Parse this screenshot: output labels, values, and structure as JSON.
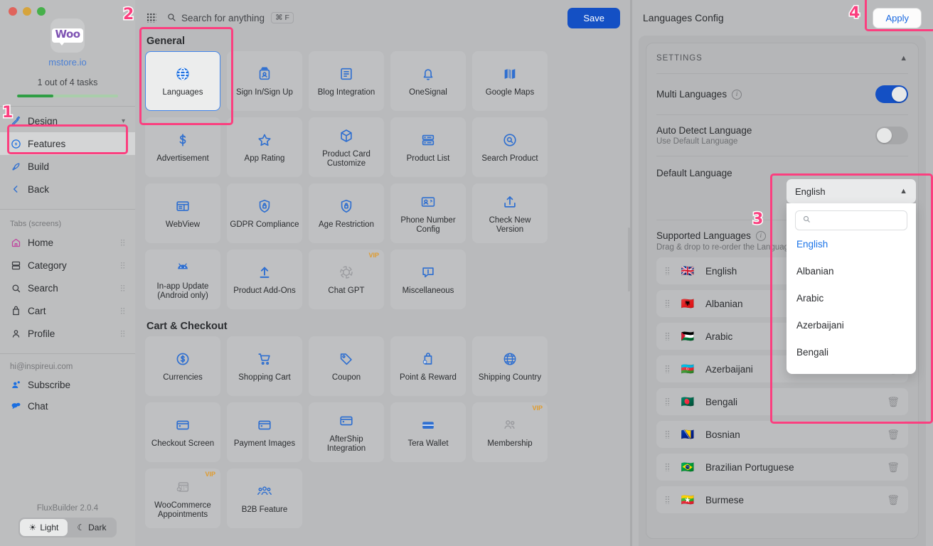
{
  "sidebar": {
    "brand_name": "mstore.io",
    "logo_text": "Woo",
    "tasks_text": "1 out of 4 tasks",
    "nav": [
      {
        "label": "Design",
        "icon": "palette-icon",
        "active": false
      },
      {
        "label": "Features",
        "icon": "bolt-icon",
        "active": true
      },
      {
        "label": "Build",
        "icon": "rocket-icon",
        "active": false
      },
      {
        "label": "Back",
        "icon": "chevron-left-icon",
        "active": false
      }
    ],
    "tabs_label": "Tabs (screens)",
    "tabs": [
      {
        "label": "Home",
        "icon": "home-icon"
      },
      {
        "label": "Category",
        "icon": "category-icon"
      },
      {
        "label": "Search",
        "icon": "search-icon"
      },
      {
        "label": "Cart",
        "icon": "cart-icon"
      },
      {
        "label": "Profile",
        "icon": "person-icon"
      }
    ],
    "email": "hi@inspireui.com",
    "links": [
      {
        "label": "Subscribe",
        "icon": "subscribe-icon"
      },
      {
        "label": "Chat",
        "icon": "chat-icon"
      }
    ],
    "version": "FluxBuilder 2.0.4",
    "theme": {
      "light": "Light",
      "dark": "Dark",
      "selected": "Light"
    }
  },
  "topbar": {
    "search_placeholder": "Search for anything",
    "shortcut": "⌘ F",
    "save_label": "Save"
  },
  "features": {
    "groups": [
      {
        "title": "General",
        "tiles": [
          {
            "label": "Languages",
            "icon": "globe-icon",
            "selected": true
          },
          {
            "label": "Sign In/Sign Up",
            "icon": "id-card-icon"
          },
          {
            "label": "Blog Integration",
            "icon": "article-icon"
          },
          {
            "label": "OneSignal",
            "icon": "bell-icon"
          },
          {
            "label": "Google Maps",
            "icon": "map-icon"
          },
          {
            "label": "Advertisement",
            "icon": "dollar-icon"
          },
          {
            "label": "App Rating",
            "icon": "star-icon"
          },
          {
            "label": "Product Card Customize",
            "icon": "box-icon"
          },
          {
            "label": "Product List",
            "icon": "list-icon"
          },
          {
            "label": "Search Product",
            "icon": "search-circle-icon"
          },
          {
            "label": "WebView",
            "icon": "webview-icon"
          },
          {
            "label": "GDPR Compliance",
            "icon": "shield-lock-icon"
          },
          {
            "label": "Age Restriction",
            "icon": "shield-lock-icon"
          },
          {
            "label": "Phone Number Config",
            "icon": "contact-phone-icon"
          },
          {
            "label": "Check New Version",
            "icon": "upload-icon"
          },
          {
            "label": "In-app Update (Android only)",
            "icon": "android-icon"
          },
          {
            "label": "Product Add-Ons",
            "icon": "upload-arrow-icon"
          },
          {
            "label": "Chat GPT",
            "icon": "openai-icon",
            "vip": "VIP",
            "dim": true
          },
          {
            "label": "Miscellaneous",
            "icon": "alert-chat-icon"
          }
        ]
      },
      {
        "title": "Cart & Checkout",
        "tiles": [
          {
            "label": "Currencies",
            "icon": "dollar-circle-icon"
          },
          {
            "label": "Shopping Cart",
            "icon": "cart-icon"
          },
          {
            "label": "Coupon",
            "icon": "tag-icon"
          },
          {
            "label": "Point & Reward",
            "icon": "bag-plus-icon"
          },
          {
            "label": "Shipping Country",
            "icon": "globe-icon"
          },
          {
            "label": "Checkout Screen",
            "icon": "card-icon"
          },
          {
            "label": "Payment Images",
            "icon": "card-icon"
          },
          {
            "label": "AfterShip Integration",
            "icon": "card-icon"
          },
          {
            "label": "Tera Wallet",
            "icon": "wallet-icon"
          },
          {
            "label": "Membership",
            "icon": "people-icon",
            "vip": "VIP",
            "dim": true
          },
          {
            "label": "WooCommerce Appointments",
            "icon": "calendar-plus-icon",
            "vip": "VIP",
            "dim": true
          },
          {
            "label": "B2B Feature",
            "icon": "group-icon"
          }
        ]
      }
    ]
  },
  "right_panel": {
    "title": "Languages Config",
    "apply_label": "Apply",
    "settings_label": "SETTINGS",
    "rows": [
      {
        "title": "Multi Languages",
        "sub": "",
        "info": true,
        "switch": "on"
      },
      {
        "title": "Auto Detect Language",
        "sub": "Use Default Language",
        "info": false,
        "switch": "off"
      },
      {
        "title": "Default Language",
        "sub": "",
        "info": false,
        "switch": "none"
      }
    ],
    "supported_title": "Supported Languages",
    "supported_sub": "Drag & drop to re-order the Language",
    "languages": [
      {
        "name": "English",
        "flag": "🇬🇧"
      },
      {
        "name": "Albanian",
        "flag": "🇦🇱"
      },
      {
        "name": "Arabic",
        "flag": "🇵🇸"
      },
      {
        "name": "Azerbaijani",
        "flag": "🇦🇿"
      },
      {
        "name": "Bengali",
        "flag": "🇧🇩"
      },
      {
        "name": "Bosnian",
        "flag": "🇧🇦"
      },
      {
        "name": "Brazilian Portuguese",
        "flag": "🇧🇷"
      },
      {
        "name": "Burmese",
        "flag": "🇲🇲"
      }
    ]
  },
  "dropdown": {
    "selected": "English",
    "search_placeholder": "",
    "options": [
      {
        "label": "English",
        "active": true
      },
      {
        "label": "Albanian",
        "active": false
      },
      {
        "label": "Arabic",
        "active": false
      },
      {
        "label": "Azerbaijani",
        "active": false
      },
      {
        "label": "Bengali",
        "active": false
      }
    ]
  },
  "annotations": {
    "one": "1",
    "two": "2",
    "three": "3",
    "four": "4",
    "accent": "#fb3f7f"
  }
}
